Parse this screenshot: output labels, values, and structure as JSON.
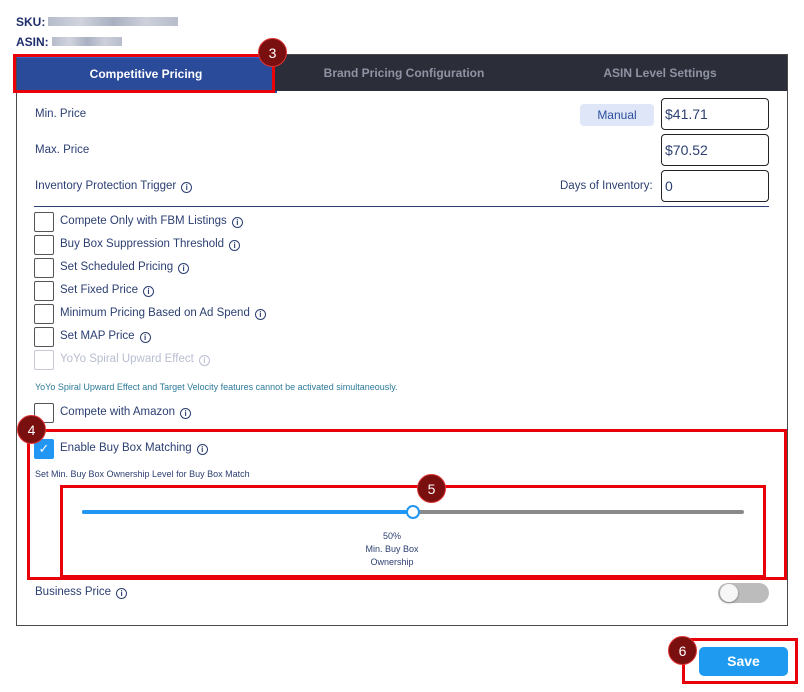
{
  "header": {
    "sku_label": "SKU:",
    "asin_label": "ASIN:"
  },
  "tabs": [
    {
      "label": "Competitive Pricing",
      "active": true
    },
    {
      "label": "Brand Pricing Configuration",
      "active": false
    },
    {
      "label": "ASIN Level Settings",
      "active": false
    }
  ],
  "pricing": {
    "min_label": "Min. Price",
    "min_mode": "Manual",
    "min_value": "$41.71",
    "max_label": "Max. Price",
    "max_value": "$70.52",
    "inventory_label": "Inventory Protection Trigger",
    "days_label": "Days of Inventory:",
    "days_value": "0"
  },
  "options": [
    {
      "label": "Compete Only with FBM Listings",
      "checked": false,
      "disabled": false
    },
    {
      "label": "Buy Box Suppression Threshold",
      "checked": false,
      "disabled": false
    },
    {
      "label": "Set Scheduled Pricing",
      "checked": false,
      "disabled": false
    },
    {
      "label": "Set Fixed Price",
      "checked": false,
      "disabled": false
    },
    {
      "label": "Minimum Pricing Based on Ad Spend",
      "checked": false,
      "disabled": false
    },
    {
      "label": "Set MAP Price",
      "checked": false,
      "disabled": false
    },
    {
      "label": "YoYo Spiral Upward Effect",
      "checked": false,
      "disabled": true
    }
  ],
  "yoyo_note": "YoYo Spiral Upward Effect and Target Velocity features cannot be activated simultaneously.",
  "compete_amazon": {
    "label": "Compete with Amazon",
    "checked": false
  },
  "buybox": {
    "label": "Enable Buy Box Matching",
    "checked": true,
    "checkmark": "✓",
    "sub_label": "Set Min. Buy Box Ownership Level for Buy Box Match",
    "slider_percent": 50,
    "slider_value": "50%",
    "slider_caption_line1": "Min. Buy Box",
    "slider_caption_line2": "Ownership"
  },
  "business_price": {
    "label": "Business Price",
    "enabled": false
  },
  "save_label": "Save",
  "annotations": [
    "3",
    "4",
    "5",
    "6"
  ],
  "colors": {
    "accent": "#2196f3",
    "tab_active": "#2a4a9a",
    "highlight": "#e8000b",
    "badge": "#7a0f0f"
  }
}
